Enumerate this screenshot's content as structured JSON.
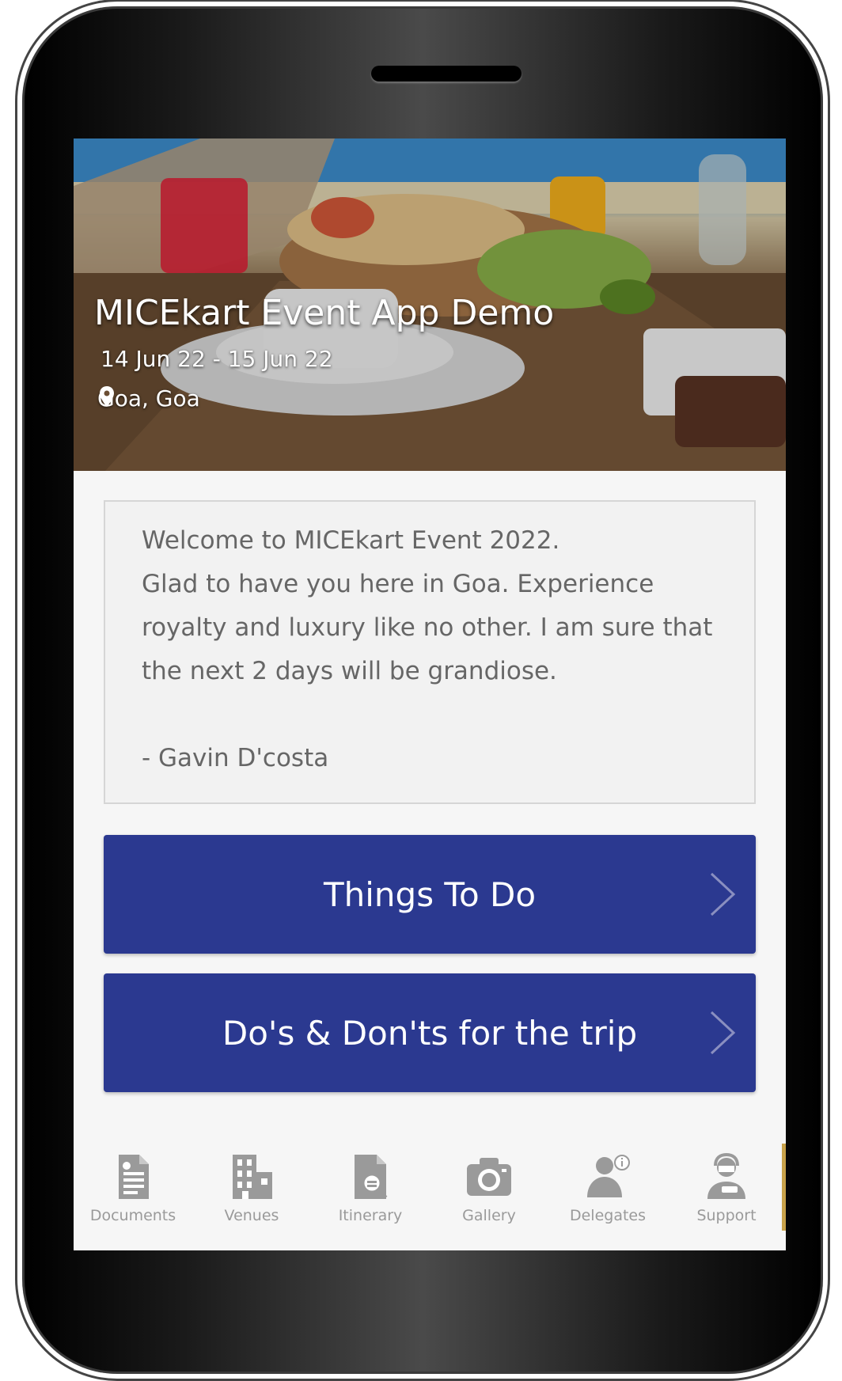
{
  "event": {
    "title": "MICEkart Event App Demo",
    "dates": "14 Jun 22 - 15 Jun 22",
    "location": "Goa, Goa"
  },
  "welcome": {
    "line1": "Welcome to MICEkart Event 2022.",
    "line2": "Glad to have you here in Goa. Experience royalty and luxury like no other. I am sure that the next 2 days will be grandiose.",
    "signature": "- Gavin D'costa"
  },
  "buttons": {
    "things_to_do": "Things To Do",
    "dos_donts": "Do's & Don'ts for the trip"
  },
  "nav": {
    "items": [
      {
        "label": "Documents",
        "icon": "document-icon"
      },
      {
        "label": "Venues",
        "icon": "building-icon"
      },
      {
        "label": "Itinerary",
        "icon": "itinerary-search-icon"
      },
      {
        "label": "Gallery",
        "icon": "camera-icon"
      },
      {
        "label": "Delegates",
        "icon": "delegates-icon"
      },
      {
        "label": "Support",
        "icon": "support-agent-icon"
      }
    ]
  },
  "colors": {
    "primary": "#2b3990",
    "nav_icon": "#9a9a9a",
    "background": "#f6f6f6"
  }
}
